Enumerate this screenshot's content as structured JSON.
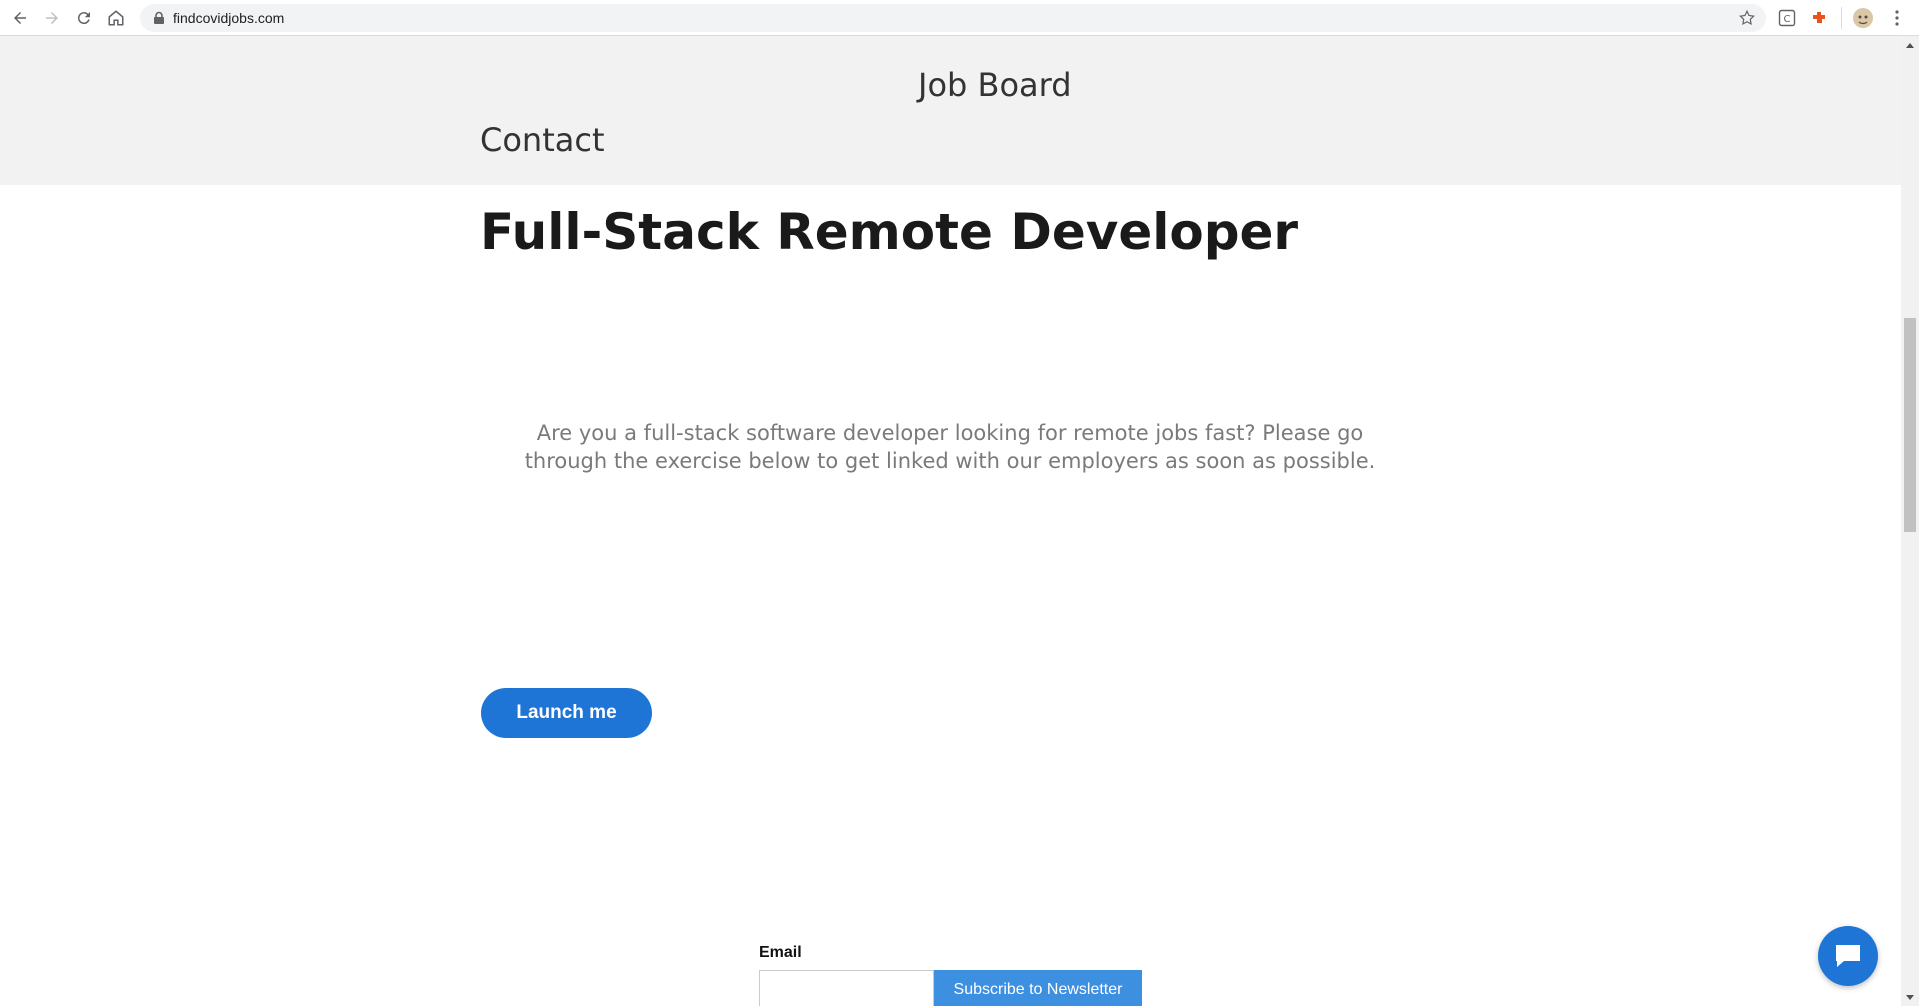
{
  "browser": {
    "url": "findcovidjobs.com"
  },
  "nav": {
    "job_board": "Job Board",
    "contact": "Contact"
  },
  "main": {
    "title": "Full-Stack Remote Developer",
    "intro": "Are you a full-stack software developer looking for remote jobs fast? Please go through the exercise below to get linked with our employers as soon as possible.",
    "launch_button": "Launch me"
  },
  "newsletter": {
    "email_label": "Email",
    "email_value": "",
    "subscribe_button": "Subscribe to Newsletter"
  },
  "icons": {
    "back": "back-arrow-icon",
    "forward": "forward-arrow-icon",
    "reload": "reload-icon",
    "home": "home-icon",
    "lock": "lock-icon",
    "bookmark": "star-icon",
    "chat": "chat-bubble-icon"
  },
  "colors": {
    "accent": "#1f75d6",
    "subscribe": "#3d8fe0",
    "header_band": "#f2f2f2",
    "intro_text": "#7a7a7a"
  }
}
